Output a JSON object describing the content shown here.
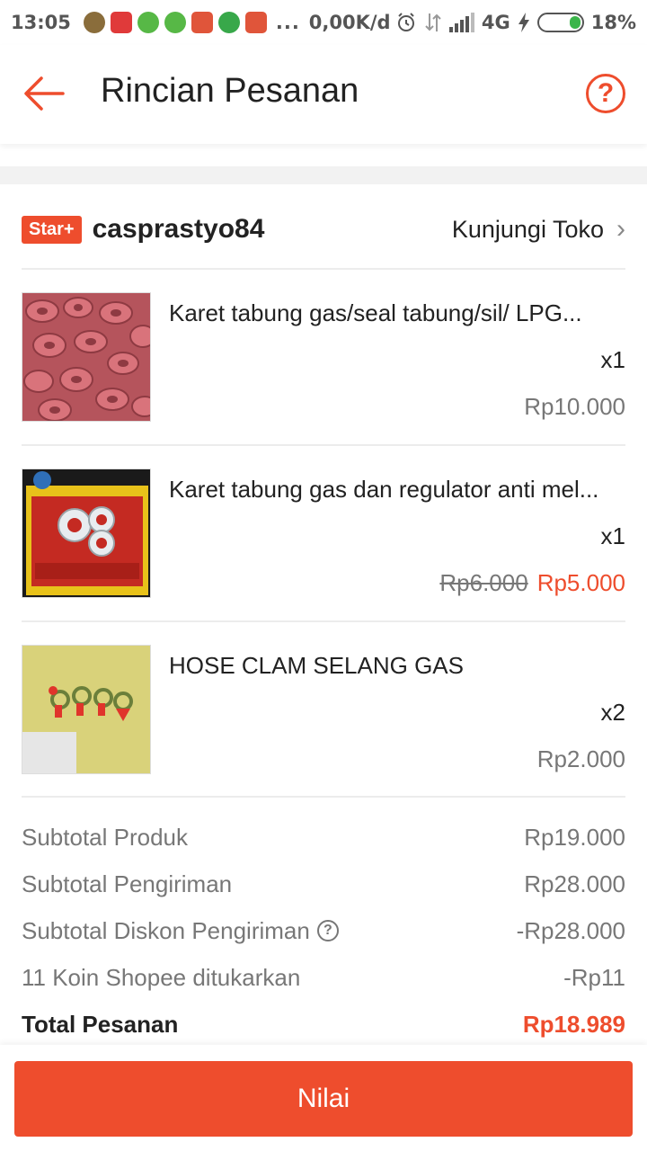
{
  "status_bar": {
    "time": "13:05",
    "net_speed": "0,00K/d",
    "dots": "...",
    "network": "4G",
    "battery": "18%",
    "notifications": [
      "avatar-icon",
      "shopback-icon",
      "line-icon",
      "line-icon",
      "shopee-icon",
      "whatsapp-icon",
      "shopee-icon"
    ]
  },
  "header": {
    "title": "Rincian Pesanan",
    "help_label": "?"
  },
  "shop": {
    "badge": "Star+",
    "name": "casprastyo84",
    "visit_label": "Kunjungi Toko"
  },
  "products": [
    {
      "name": "Karet tabung gas/seal tabung/sil/ LPG...",
      "qty": "x1",
      "price": "Rp10.000"
    },
    {
      "name": "Karet tabung gas dan regulator anti mel...",
      "qty": "x1",
      "old_price": "Rp6.000",
      "price": "Rp5.000"
    },
    {
      "name": "HOSE CLAM SELANG GAS",
      "qty": "x2",
      "price": "Rp2.000"
    }
  ],
  "summary": {
    "product_label": "Subtotal Produk",
    "product_value": "Rp19.000",
    "shipping_label": "Subtotal Pengiriman",
    "shipping_value": "Rp28.000",
    "discount_label": "Subtotal Diskon Pengiriman",
    "discount_value": "-Rp28.000",
    "coins_label": "11 Koin Shopee ditukarkan",
    "coins_value": "-Rp11",
    "total_label": "Total Pesanan",
    "total_value": "Rp18.989"
  },
  "action": {
    "rate_label": "Nilai"
  },
  "colors": {
    "accent": "#ee4d2d",
    "muted_text": "#777777",
    "divider": "#ececec"
  }
}
